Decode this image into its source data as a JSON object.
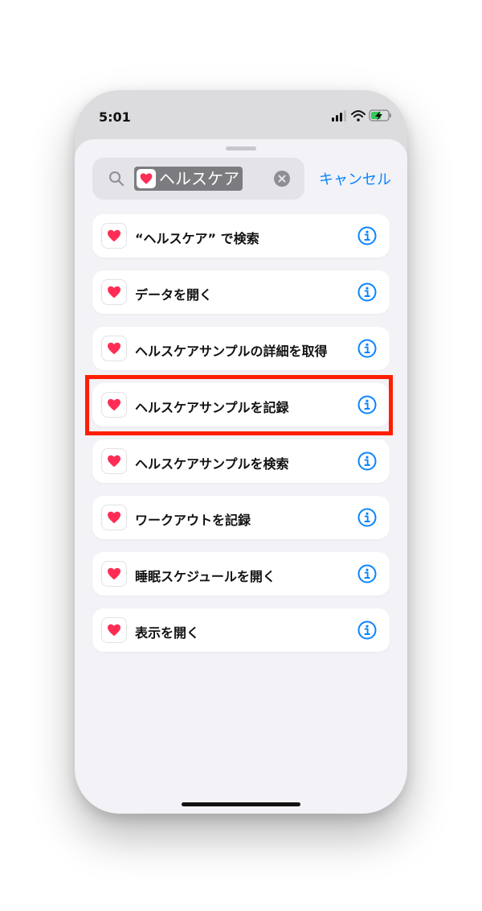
{
  "status_bar": {
    "time": "5:01"
  },
  "search": {
    "token_label": "ヘルスケア"
  },
  "cancel_label": "キャンセル",
  "actions": [
    {
      "label": "“ヘルスケア” で検索"
    },
    {
      "label": "データを開く"
    },
    {
      "label": "ヘルスケアサンプルの詳細を取得"
    },
    {
      "label": "ヘルスケアサンプルを記録",
      "highlighted": true
    },
    {
      "label": "ヘルスケアサンプルを検索"
    },
    {
      "label": "ワークアウトを記録"
    },
    {
      "label": "睡眠スケジュールを開く"
    },
    {
      "label": "表示を開く"
    }
  ],
  "colors": {
    "accent": "#0a84ff",
    "heart": "#ff2d55",
    "highlight": "#ff1f00"
  },
  "icons": {
    "app": "heart-icon",
    "search": "magnifier-icon",
    "clear": "clear-x-icon",
    "info": "info-circle-icon"
  }
}
